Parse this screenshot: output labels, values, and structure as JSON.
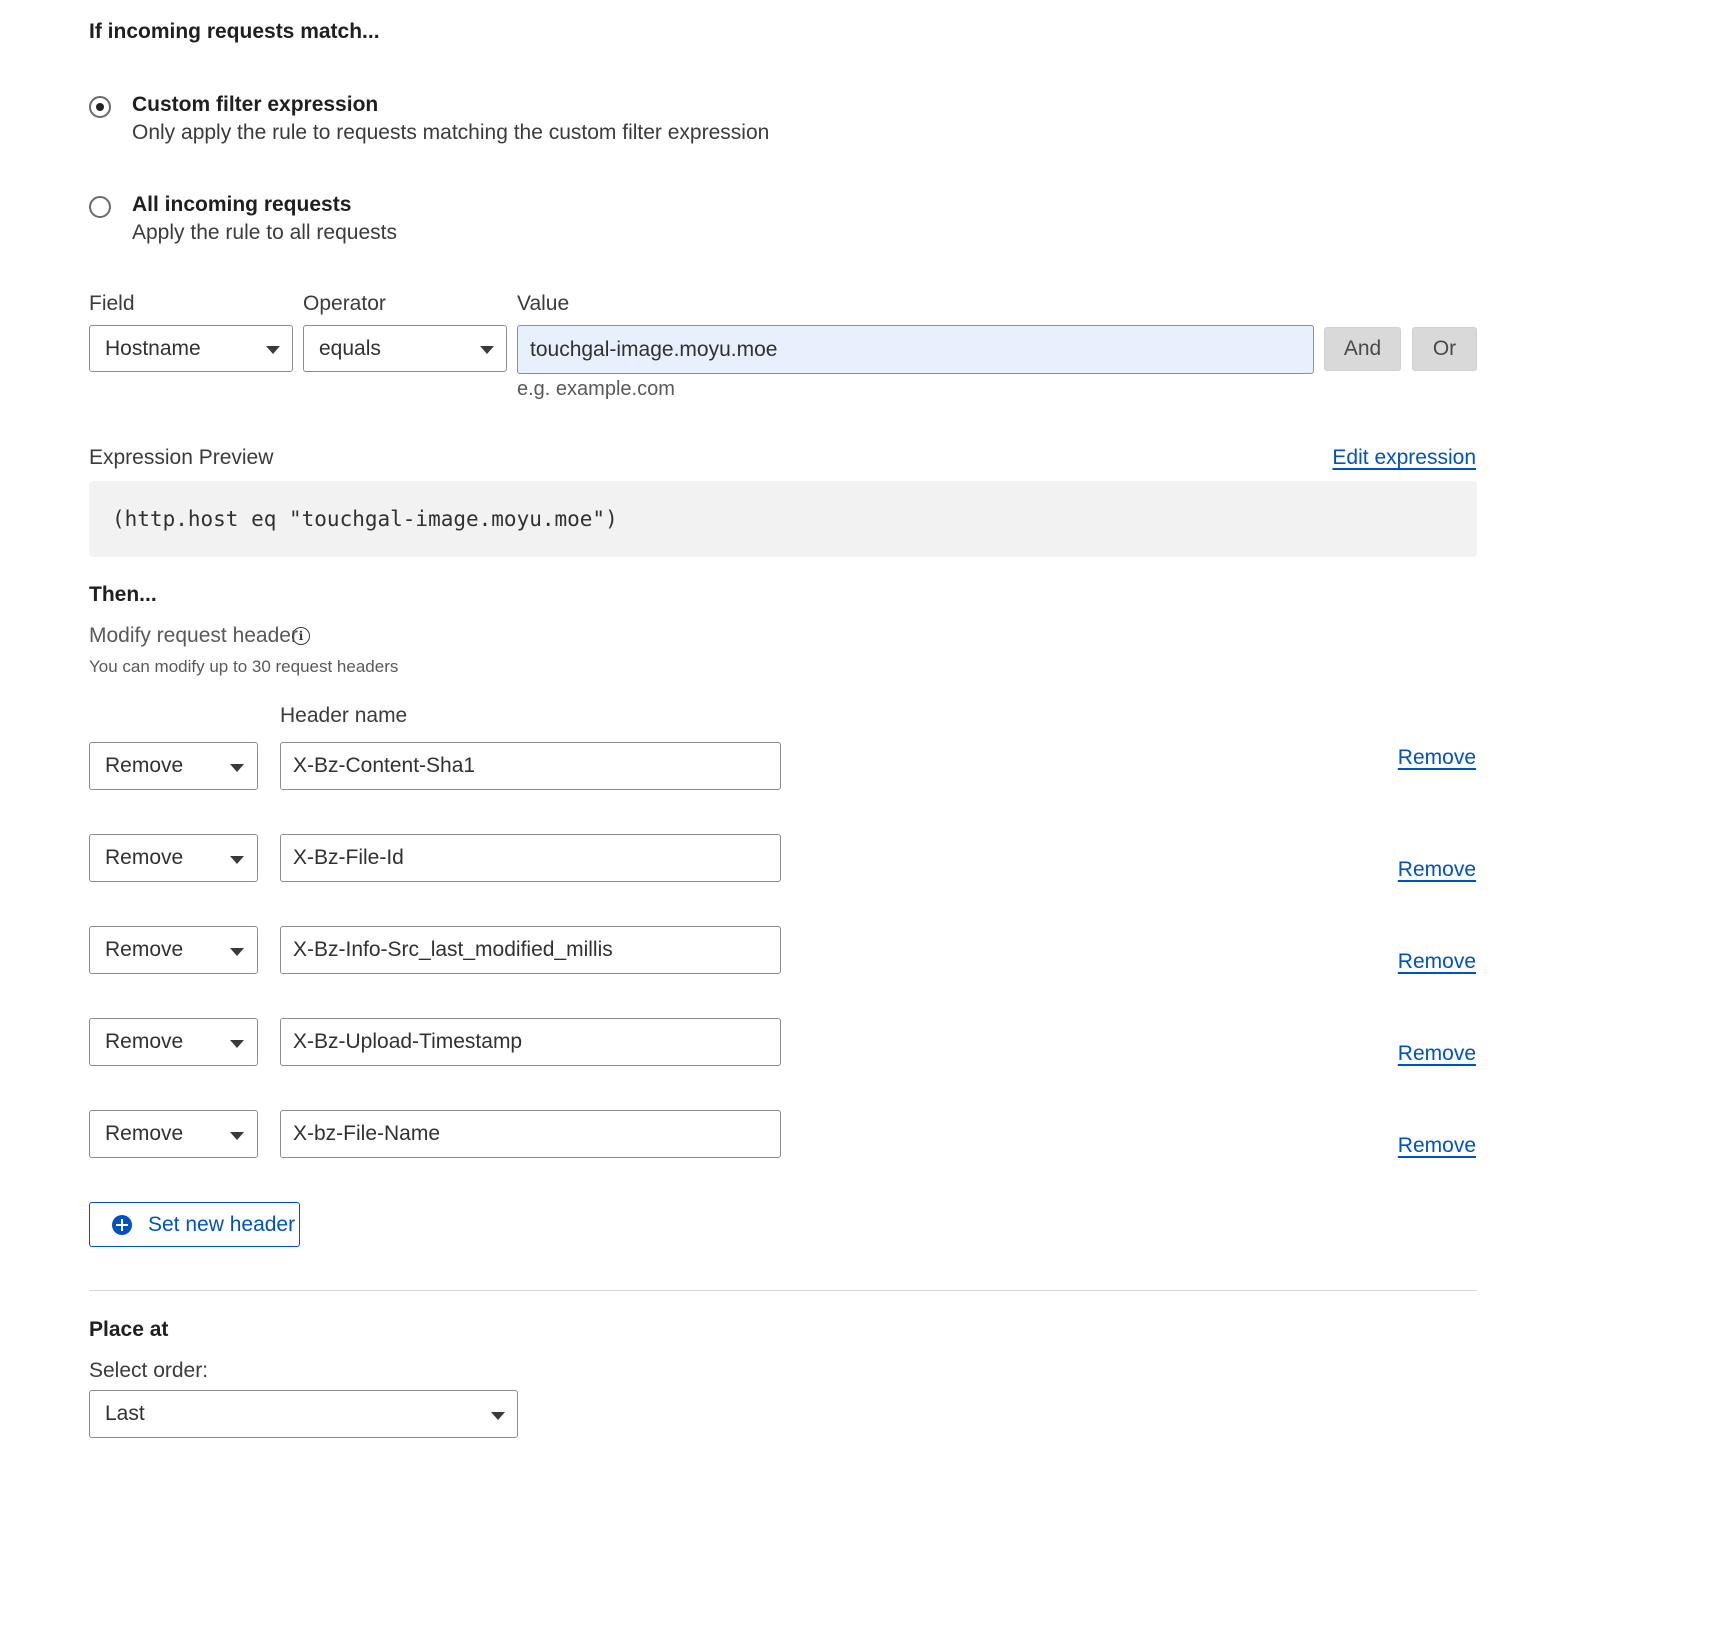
{
  "match": {
    "heading": "If incoming requests match...",
    "options": [
      {
        "title": "Custom filter expression",
        "description": "Only apply the rule to requests matching the custom filter expression",
        "selected": true
      },
      {
        "title": "All incoming requests",
        "description": "Apply the rule to all requests",
        "selected": false
      }
    ]
  },
  "filter": {
    "field_label": "Field",
    "field_value": "Hostname",
    "operator_label": "Operator",
    "operator_value": "equals",
    "value_label": "Value",
    "value_value": "touchgal-image.moyu.moe",
    "value_hint": "e.g. example.com",
    "and_label": "And",
    "or_label": "Or"
  },
  "expression": {
    "label": "Expression Preview",
    "edit_link": "Edit expression",
    "code": "(http.host eq \"touchgal-image.moyu.moe\")"
  },
  "then": {
    "heading": "Then...",
    "action_label": "Modify request header",
    "info_icon": "info-icon",
    "note": "You can modify up to 30 request headers",
    "header_name_label": "Header name",
    "headers": [
      {
        "operation": "Remove",
        "name": "X-Bz-Content-Sha1",
        "remove_link": "Remove"
      },
      {
        "operation": "Remove",
        "name": "X-Bz-File-Id",
        "remove_link": "Remove"
      },
      {
        "operation": "Remove",
        "name": "X-Bz-Info-Src_last_modified_millis",
        "remove_link": "Remove"
      },
      {
        "operation": "Remove",
        "name": "X-Bz-Upload-Timestamp",
        "remove_link": "Remove"
      },
      {
        "operation": "Remove",
        "name": "X-bz-File-Name",
        "remove_link": "Remove"
      }
    ],
    "set_new_header": "Set new header"
  },
  "place": {
    "heading": "Place at",
    "order_label": "Select order:",
    "order_value": "Last"
  },
  "colors": {
    "accent": "#0051c3",
    "input_focus_bg": "#e8f0fd",
    "code_bg": "#f2f2f2"
  }
}
